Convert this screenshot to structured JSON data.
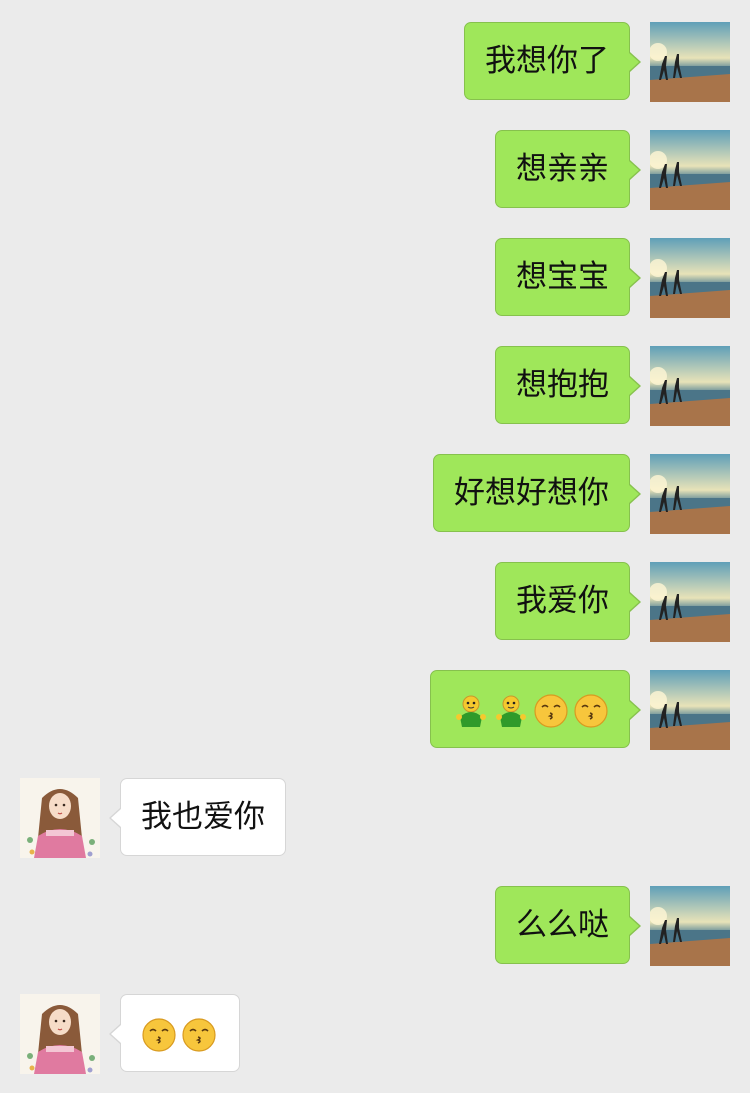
{
  "messages": [
    {
      "sender": "me",
      "text": "我想你了"
    },
    {
      "sender": "me",
      "text": "想亲亲"
    },
    {
      "sender": "me",
      "text": "想宝宝"
    },
    {
      "sender": "me",
      "text": "想抱抱"
    },
    {
      "sender": "me",
      "text": "好想好想你"
    },
    {
      "sender": "me",
      "text": "我爱你"
    },
    {
      "sender": "me",
      "emojis": [
        "green-figure-icon",
        "green-figure-icon",
        "kissing-face-icon",
        "kissing-face-icon"
      ]
    },
    {
      "sender": "them",
      "text": "我也爱你"
    },
    {
      "sender": "me",
      "text": "么么哒"
    },
    {
      "sender": "them",
      "emojis": [
        "kissing-face-icon",
        "kissing-face-icon"
      ]
    }
  ],
  "colors": {
    "background": "#ebebeb",
    "sent_bubble": "#9fe75a",
    "received_bubble": "#ffffff"
  },
  "avatars": {
    "me": "beach-photo-avatar",
    "them": "illustrated-girl-avatar"
  }
}
